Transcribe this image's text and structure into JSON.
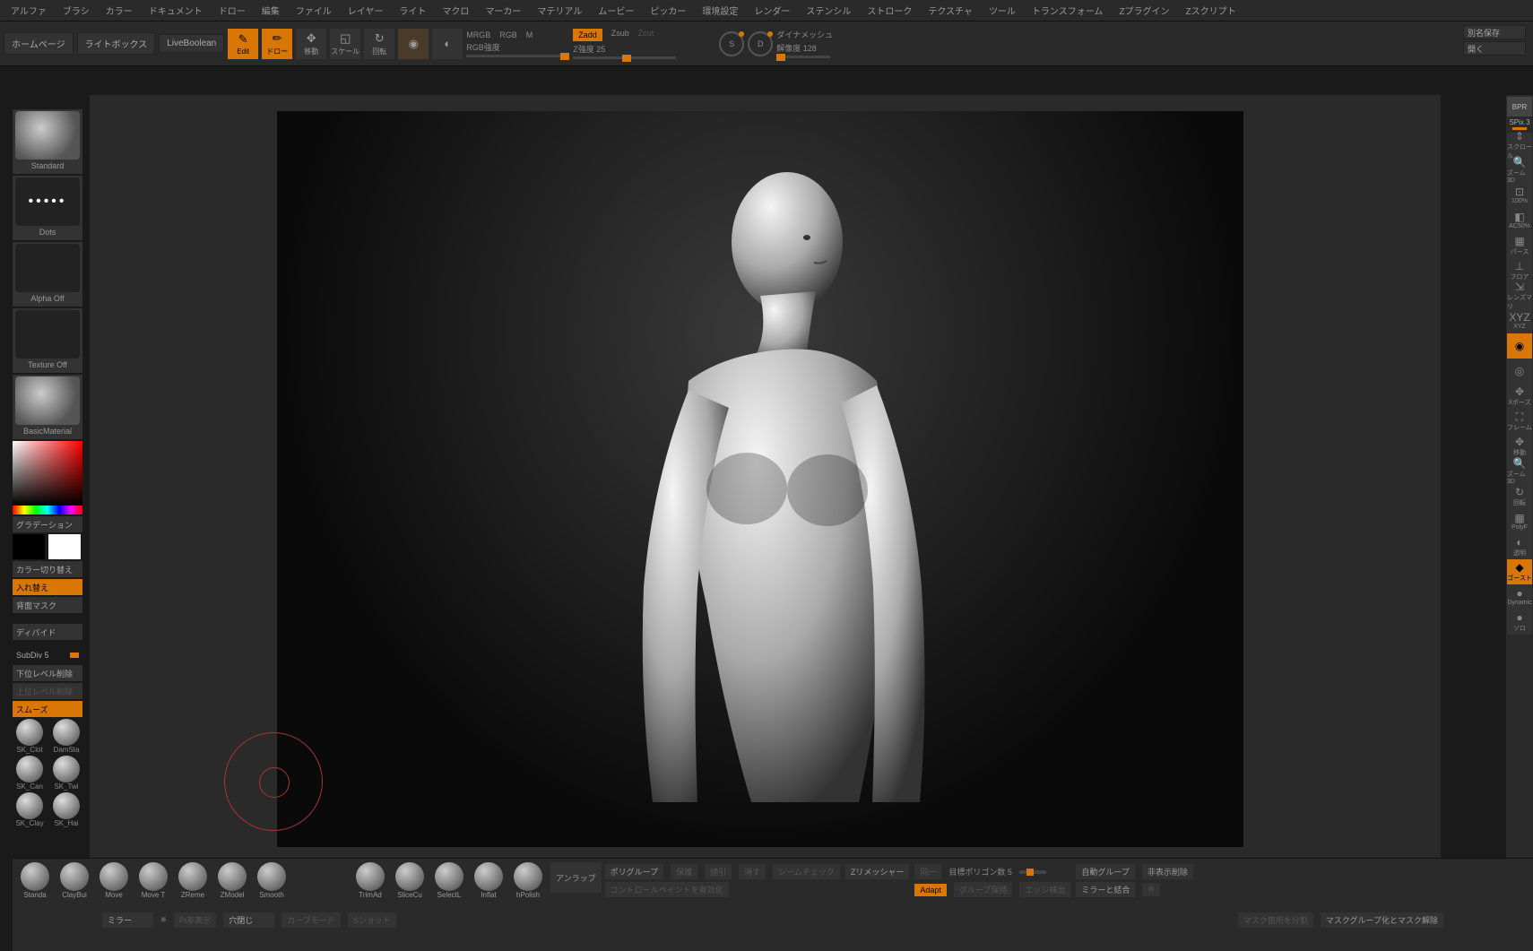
{
  "menu": [
    "アルファ",
    "ブラシ",
    "カラー",
    "ドキュメント",
    "ドロー",
    "編集",
    "ファイル",
    "レイヤー",
    "ライト",
    "マクロ",
    "マーカー",
    "マテリアル",
    "ムービー",
    "ピッカー",
    "環境設定",
    "レンダー",
    "ステンシル",
    "ストローク",
    "テクスチャ",
    "ツール",
    "トランスフォーム",
    "Zプラグイン",
    "Zスクリプト"
  ],
  "topbar": {
    "homepage": "ホームページ",
    "lightbox": "ライトボックス",
    "liveboolean": "LiveBoolean",
    "edit": "Edit",
    "draw": "ドロー",
    "move": "移動",
    "scale": "スケール",
    "rotate": "回転",
    "mrgb": "MRGB",
    "rgb": "RGB",
    "m": "M",
    "rgbstrength": "RGB強度",
    "zadd": "Zadd",
    "zsub": "Zsub",
    "zcut": "Zcut",
    "zintensity": "Z強度 25",
    "s": "S",
    "d": "D",
    "dynamesh": "ダイナメッシュ",
    "resolution": "解像度 128",
    "saveas": "別名保存",
    "open": "開く"
  },
  "left": {
    "brush": "Standard",
    "stroke": "Dots",
    "alpha": "Alpha Off",
    "texture": "Texture Off",
    "material": "BasicMaterial",
    "gradation": "グラデーション",
    "colorswap": "カラー切り替え",
    "swap": "入れ替え",
    "backmask": "背面マスク",
    "divide": "ディバイド",
    "subdiv": "SubDiv 5",
    "dellower": "下位レベル削除",
    "delupper": "上位レベル削除",
    "smooth": "スムーズ",
    "minibrushes": [
      "SK_Clot",
      "DamSta",
      "SK_Can",
      "SK_Twi",
      "SK_Clay",
      "SK_Hai"
    ]
  },
  "right": {
    "bpr": "BPR",
    "spix": "SPix 3",
    "btns": [
      "スクロール",
      "ズーム3D",
      "100%",
      "AC50%",
      "パース",
      "フロア",
      "レンズマリ",
      "XYZ",
      "",
      "",
      "Xポーズ",
      "フレーム",
      "移動",
      "ズーム3D",
      "回転",
      "PolyF",
      "透明",
      "ゴースト",
      "Dynamic",
      "ソロ"
    ]
  },
  "bottom": {
    "brushes": [
      "Standa",
      "ClayBui",
      "Move",
      "Move T",
      "ZReme",
      "ZModel",
      "Smooth"
    ],
    "brushes2": [
      "TrimAd",
      "SliceCu",
      "SelectL",
      "Inflat",
      "hPolish"
    ],
    "unwrap": "アンラップ",
    "polygroup": "ポリグループ",
    "protect": "保護",
    "guide": "誘引",
    "erase": "消す",
    "seamcheck": "シームチェック",
    "controlpaint": "コントロールペイントを有効化",
    "zremesher": "Zリメッシャー",
    "same": "同一",
    "targetpoly": "目標ポリゴン数 5",
    "adapt": "Adapt",
    "keepgroups": "グループ保持",
    "edgedetect": "エッジ検出",
    "autogroup": "自動グループ",
    "hidedelete": "非表示削除",
    "mirrormerge": "ミラーと結合",
    "mirror": "ミラー",
    "pthide": "Pt非表示",
    "closehole": "穴閉じ",
    "curvemode": "カーブモード",
    "sshot": "Sショット",
    "masksplit": "マスク箇所を分割",
    "maskgroupunmask": "マスクグループ化とマスク解除"
  }
}
